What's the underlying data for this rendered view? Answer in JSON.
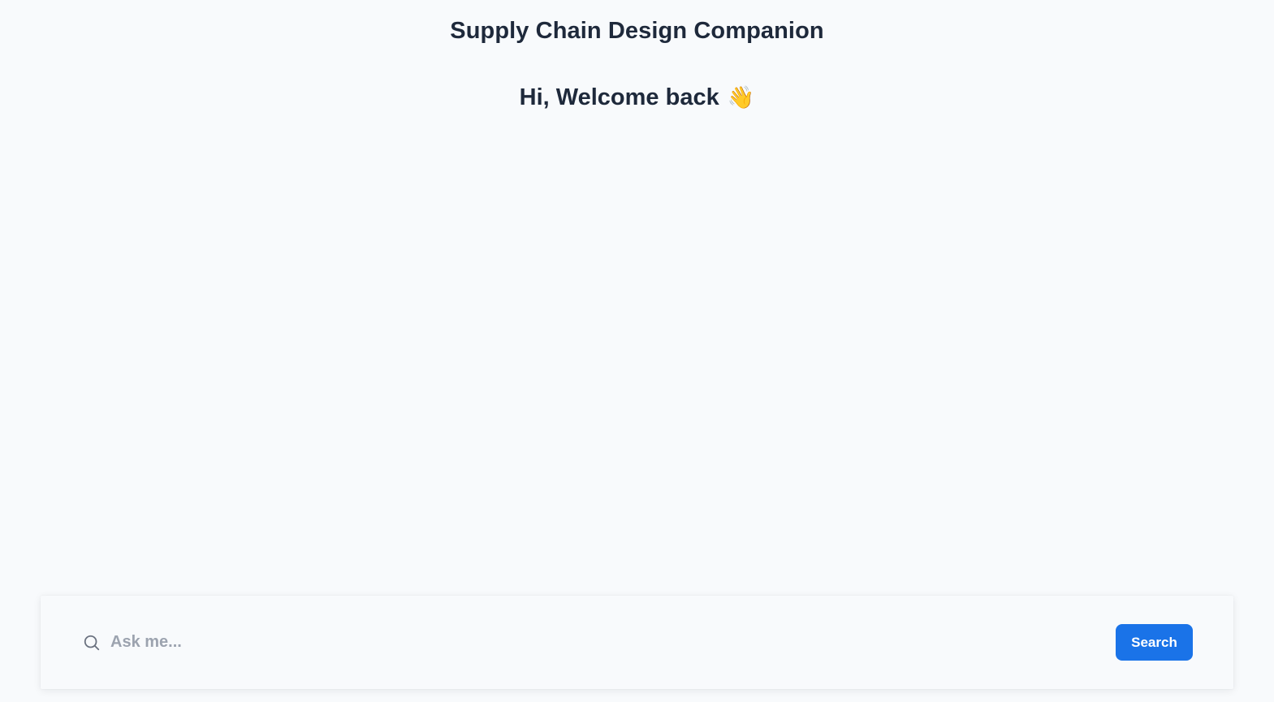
{
  "header": {
    "title": "Supply Chain Design Companion"
  },
  "main": {
    "greeting": "Hi, Welcome back",
    "greeting_emoji": "👋"
  },
  "search": {
    "placeholder": "Ask me...",
    "value": "",
    "button_label": "Search",
    "icon": "search-icon"
  },
  "colors": {
    "accent": "#1a73e8",
    "background": "#f8fafc",
    "title_text": "#1e293b",
    "placeholder_text": "#9ca3af"
  }
}
